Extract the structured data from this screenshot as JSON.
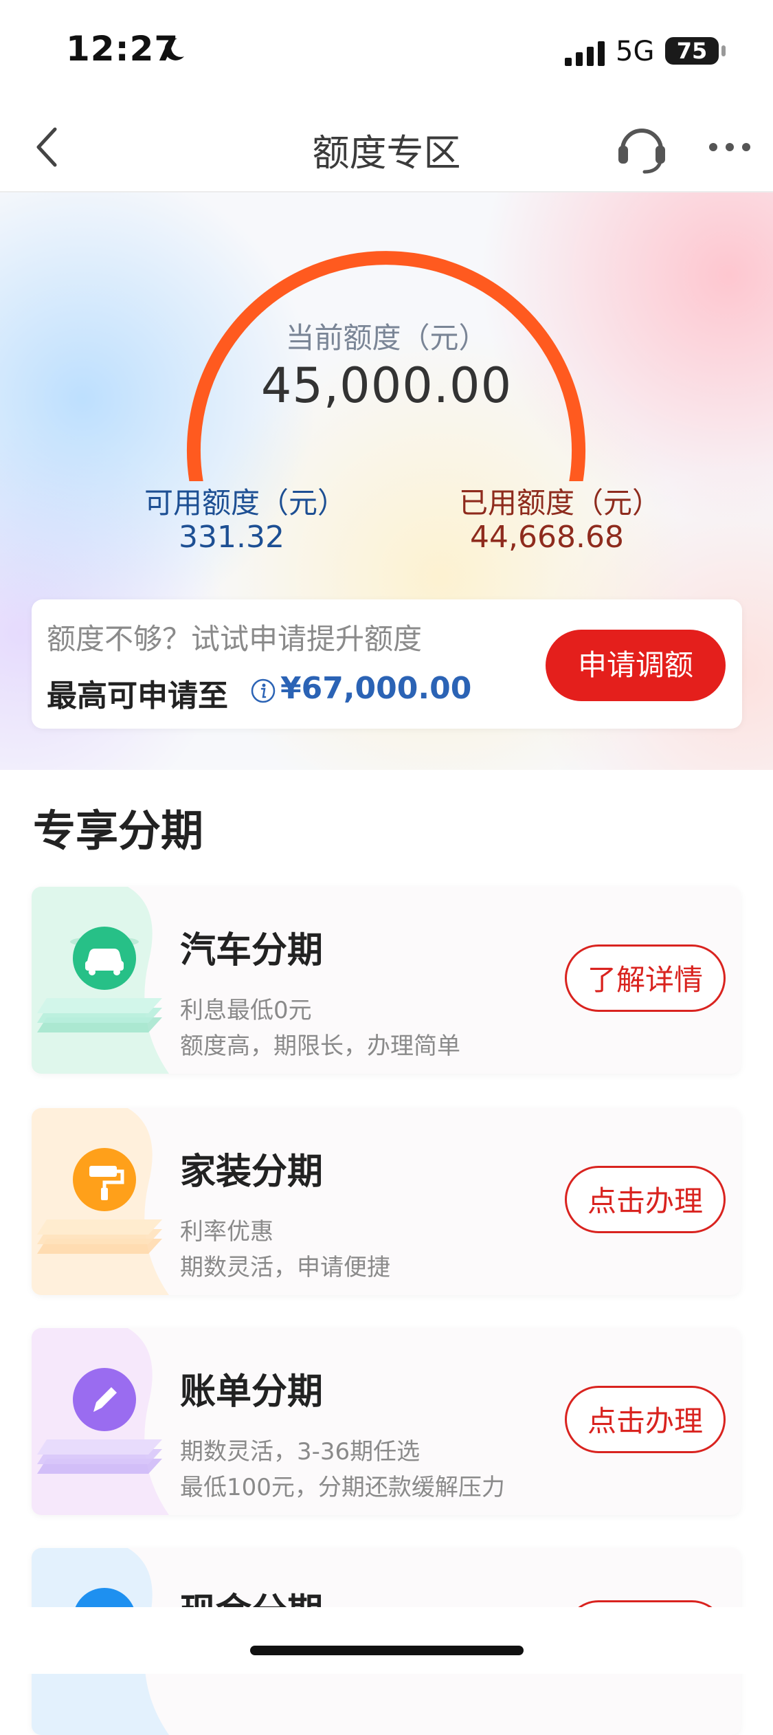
{
  "status_bar": {
    "time": "12:27",
    "network": "5G",
    "battery": "75"
  },
  "nav": {
    "title": "额度专区",
    "back_icon": "chevron-left-icon",
    "service_icon": "headset-icon",
    "more_icon": "more-dots-icon"
  },
  "quota": {
    "current_label": "当前额度（元）",
    "current_value": "45,000.00",
    "available_label": "可用额度（元）",
    "available_value": "331.32",
    "used_label": "已用额度（元）",
    "used_value": "44,668.68",
    "available_fraction": 0.0074,
    "arc_color": "#ff5a1f",
    "available_color": "#4d8df5"
  },
  "raise": {
    "tip": "额度不够？试试申请提升额度",
    "max_label": "最高可申请至",
    "max_amount": "¥67,000.00",
    "button": "申请调额"
  },
  "section": {
    "title": "专享分期"
  },
  "plans": [
    {
      "title": "汽车分期",
      "line1": "利息最低0元",
      "line2": "额度高，期限长，办理简单",
      "button": "了解详情",
      "icon": "car-icon",
      "color": "#27c087"
    },
    {
      "title": "家装分期",
      "line1": "利率优惠",
      "line2": "期数灵活，申请便捷",
      "button": "点击办理",
      "icon": "paint-roller-icon",
      "color": "#ffa01a"
    },
    {
      "title": "账单分期",
      "line1": "期数灵活，3-36期任选",
      "line2": "最低100元，分期还款缓解压力",
      "button": "点击办理",
      "icon": "pencil-icon",
      "color": "#9a6cf0"
    },
    {
      "title": "现金分期",
      "icon": "cash-icon",
      "color": "#1e90f0"
    }
  ]
}
